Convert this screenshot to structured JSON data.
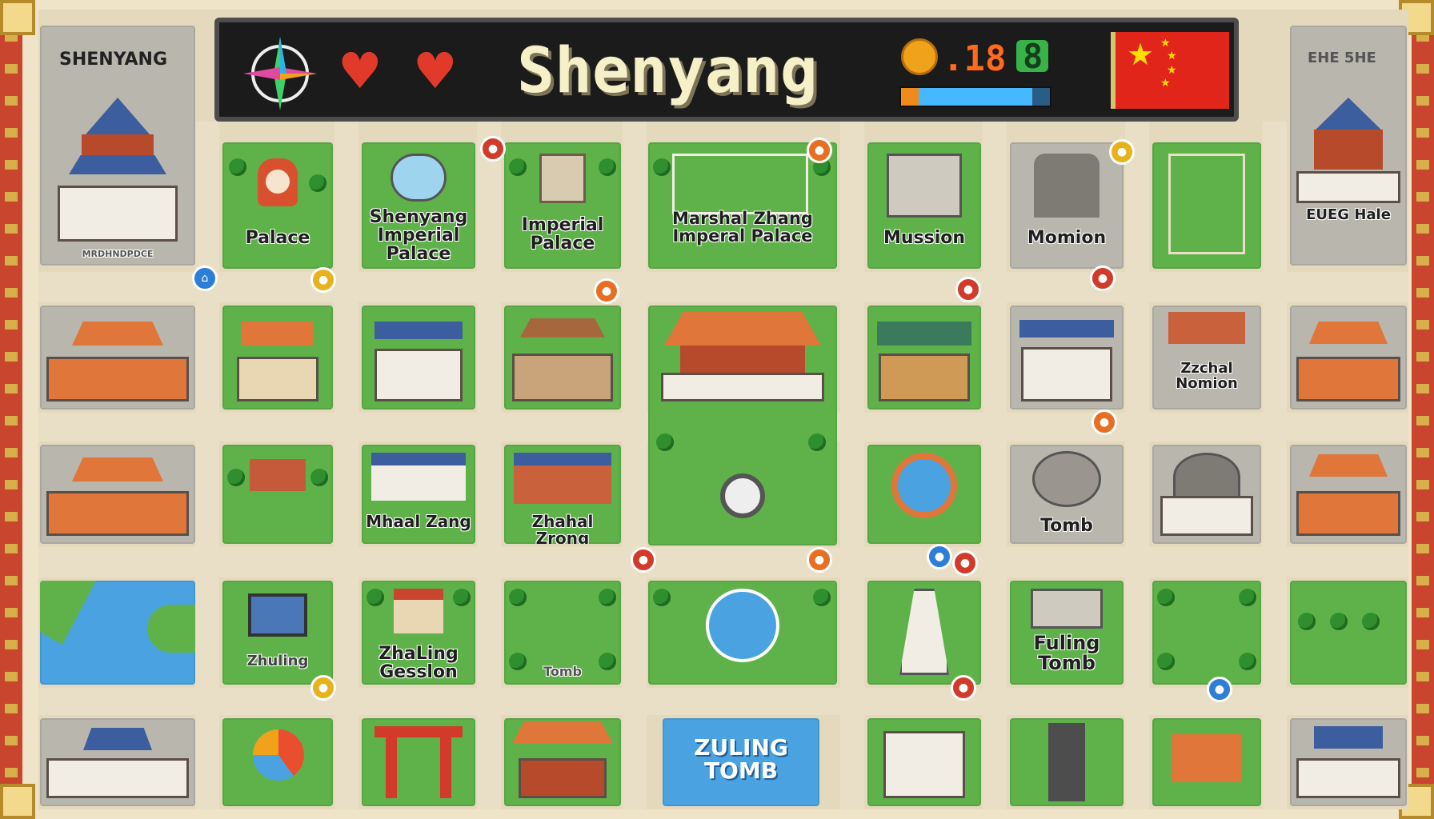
{
  "hud": {
    "title": "Shenyang",
    "lives": 2,
    "coins": ".18",
    "gems": "8",
    "progress": 0.88
  },
  "corner_labels": {
    "top_left": "SHENYANG",
    "top_right": "EHE 5HE"
  },
  "map_labels": {
    "palace_1": "Palace",
    "palace_1_sub": "MRDHNDPDCE",
    "shenyang_imperial": "Shenyang Imperial Palace",
    "imperial_palace": "Imperial Palace",
    "marshal_zhang": "Marshal Zhang Imperal Palace",
    "mussion": "Mussion",
    "momion": "Momion",
    "right_top": "EUEG Hale",
    "right_mid": "Zzchal Nomion",
    "mhaal_zang": "Mhaal Zang",
    "zhahal_zrong": "Zhahal Zrong",
    "tomb": "Tomb",
    "zhuling": "Zhuling",
    "zhaling_mission": "ZhaLing Gesslon",
    "tomb_small": "Tomb",
    "fuling_tomb": "Fuling Tomb",
    "zuling_tomb": "ZULING TOMB"
  },
  "colors": {
    "hud_bg": "#1b1b1b",
    "grass": "#5fb24a",
    "road": "#e9dfc6",
    "water": "#4aa3e0",
    "roof_orange": "#e0763a",
    "roof_blue": "#3c5e9e"
  },
  "icons": [
    "compass-icon",
    "heart-icon",
    "coin-icon",
    "gem-icon",
    "china-flag-icon",
    "map-pin-icon",
    "crosshair-icon"
  ]
}
